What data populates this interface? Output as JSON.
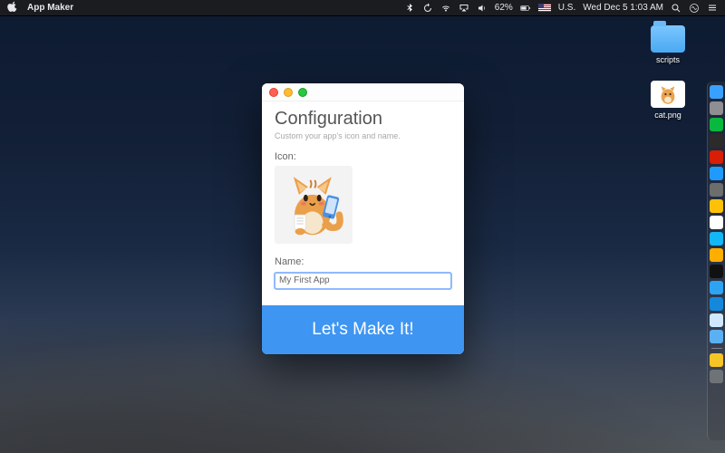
{
  "menubar": {
    "app_name": "App Maker",
    "battery_pct": "62%",
    "locale": "U.S.",
    "datetime": "Wed Dec 5  1:03 AM"
  },
  "desktop": {
    "items": [
      {
        "label": "scripts",
        "kind": "folder"
      },
      {
        "label": "cat.png",
        "kind": "image"
      }
    ]
  },
  "dock": {
    "items": [
      {
        "name": "finder",
        "color": "#3aa0ff"
      },
      {
        "name": "launchpad",
        "color": "#8e8e93"
      },
      {
        "name": "wechat",
        "color": "#09b83e"
      },
      {
        "name": "nosleep",
        "color": "#2b2b2b"
      },
      {
        "name": "netease",
        "color": "#d81e06"
      },
      {
        "name": "safari",
        "color": "#1f9bff"
      },
      {
        "name": "x",
        "color": "#6d6d6d"
      },
      {
        "name": "y",
        "color": "#ffc107"
      },
      {
        "name": "z",
        "color": "#ffffff"
      },
      {
        "name": "qq",
        "color": "#12b7f5"
      },
      {
        "name": "sketch",
        "color": "#ffae00"
      },
      {
        "name": "terminal",
        "color": "#111"
      },
      {
        "name": "vscode",
        "color": "#2ea3f2"
      },
      {
        "name": "xcode",
        "color": "#1488db"
      },
      {
        "name": "appmaker",
        "color": "#cfe8ff"
      },
      {
        "name": "folder2",
        "color": "#5ab0f2"
      }
    ],
    "trays": [
      {
        "name": "doc",
        "color": "#f5c427"
      },
      {
        "name": "trash",
        "color": "#6e7377"
      }
    ]
  },
  "window": {
    "title": "Configuration",
    "subtitle": "Custom your app's icon and name.",
    "icon_label": "Icon:",
    "name_label": "Name:",
    "name_value": "My First App",
    "cta": "Let's Make It!"
  }
}
